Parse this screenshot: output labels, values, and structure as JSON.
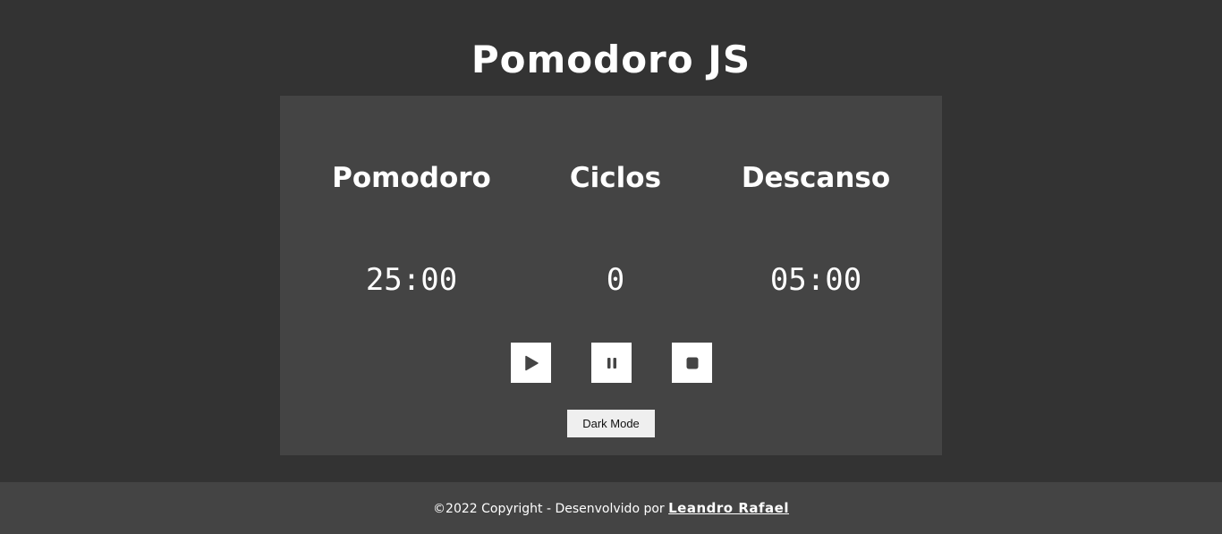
{
  "header": {
    "title": "Pomodoro JS"
  },
  "panels": [
    {
      "label": "Pomodoro",
      "value": "25:00"
    },
    {
      "label": "Ciclos",
      "value": "0"
    },
    {
      "label": "Descanso",
      "value": "05:00"
    }
  ],
  "controls": {
    "play_icon": "play-icon",
    "pause_icon": "pause-icon",
    "stop_icon": "stop-icon",
    "dark_mode_label": "Dark Mode"
  },
  "footer": {
    "text": "©2022 Copyright - Desenvolvido por ",
    "author_link": "Leandro Rafael"
  },
  "colors": {
    "background": "#333333",
    "card": "#444444",
    "text": "#ffffff",
    "button": "#ffffff",
    "icon": "#444444"
  }
}
